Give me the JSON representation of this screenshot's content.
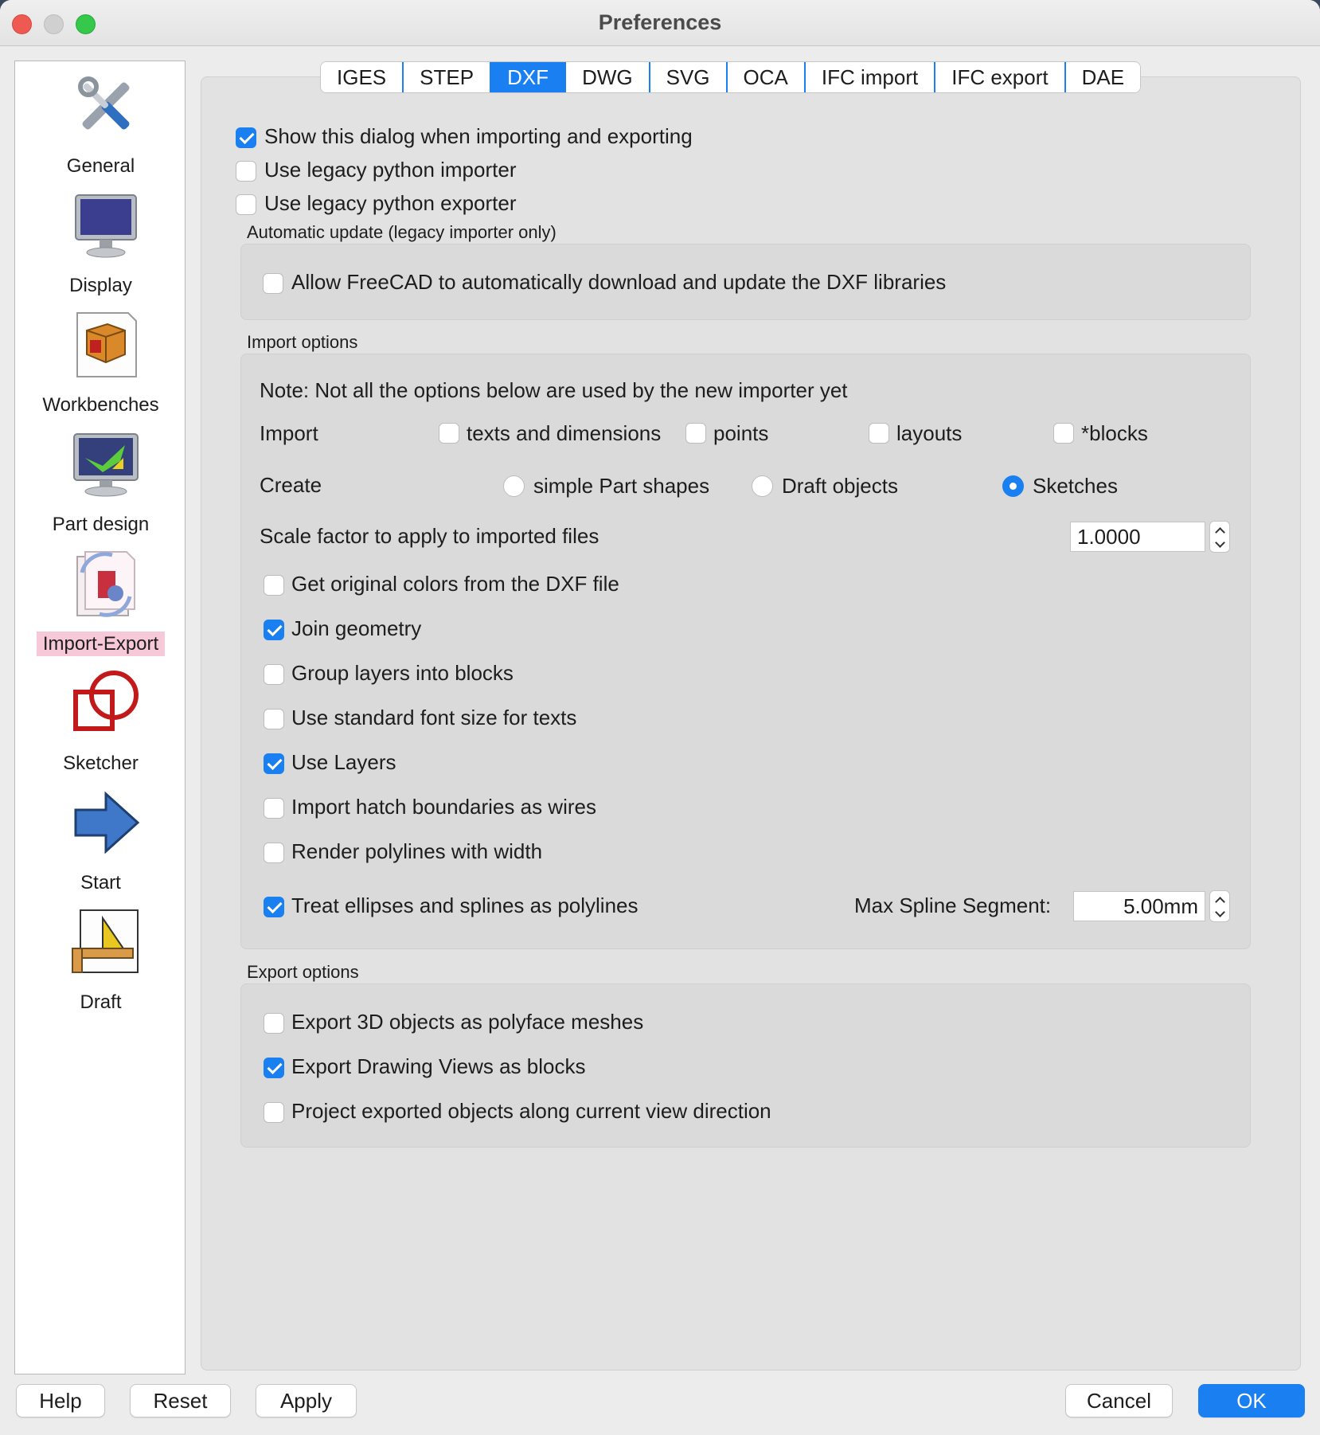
{
  "window": {
    "title": "Preferences"
  },
  "sidebar": {
    "items": [
      {
        "label": "General",
        "icon": "tools-icon"
      },
      {
        "label": "Display",
        "icon": "monitor-icon"
      },
      {
        "label": "Workbenches",
        "icon": "package-icon"
      },
      {
        "label": "Part design",
        "icon": "part-design-icon"
      },
      {
        "label": "Import-Export",
        "icon": "import-export-icon",
        "active": true
      },
      {
        "label": "Sketcher",
        "icon": "sketcher-icon"
      },
      {
        "label": "Start",
        "icon": "arrow-right-icon"
      },
      {
        "label": "Draft",
        "icon": "draft-icon"
      }
    ]
  },
  "tabs": [
    "IGES",
    "STEP",
    "DXF",
    "DWG",
    "SVG",
    "OCA",
    "IFC import",
    "IFC export",
    "DAE"
  ],
  "active_tab": "DXF",
  "general": {
    "show_dialog": {
      "label": "Show this dialog when importing and exporting",
      "checked": true
    },
    "legacy_importer": {
      "label": "Use legacy python importer",
      "checked": false
    },
    "legacy_exporter": {
      "label": "Use legacy python exporter",
      "checked": false
    }
  },
  "auto_update": {
    "title": "Automatic update (legacy importer only)",
    "allow_download": {
      "label": "Allow FreeCAD to automatically download and update the DXF libraries",
      "checked": false
    }
  },
  "import_options": {
    "title": "Import options",
    "note": "Note: Not all the options below are used by the new importer yet",
    "import_label": "Import",
    "import_items": [
      {
        "label": "texts and dimensions",
        "checked": false
      },
      {
        "label": "points",
        "checked": false
      },
      {
        "label": "layouts",
        "checked": false
      },
      {
        "label": "*blocks",
        "checked": false
      }
    ],
    "create_label": "Create",
    "create_items": [
      {
        "label": "simple Part shapes",
        "checked": false
      },
      {
        "label": "Draft objects",
        "checked": false
      },
      {
        "label": "Sketches",
        "checked": true
      }
    ],
    "scale_label": "Scale factor to apply to imported files",
    "scale_value": "1.0000",
    "options": [
      {
        "label": "Get original colors from the DXF file",
        "checked": false
      },
      {
        "label": "Join geometry",
        "checked": true
      },
      {
        "label": "Group layers into blocks",
        "checked": false
      },
      {
        "label": "Use standard font size for texts",
        "checked": false
      },
      {
        "label": "Use Layers",
        "checked": true
      },
      {
        "label": "Import hatch boundaries as wires",
        "checked": false
      },
      {
        "label": "Render polylines with width",
        "checked": false
      },
      {
        "label": "Treat ellipses and splines as polylines",
        "checked": true
      }
    ],
    "max_spline_label": "Max Spline Segment:",
    "max_spline_value": "5.00mm"
  },
  "export_options": {
    "title": "Export options",
    "options": [
      {
        "label": "Export 3D objects as polyface meshes",
        "checked": false
      },
      {
        "label": "Export Drawing Views as blocks",
        "checked": true
      },
      {
        "label": "Project exported objects along current view direction",
        "checked": false
      }
    ]
  },
  "buttons": {
    "help": "Help",
    "reset": "Reset",
    "apply": "Apply",
    "cancel": "Cancel",
    "ok": "OK"
  },
  "colors": {
    "accent": "#1a7ff0",
    "active_sidebar": "#f7c9d8"
  }
}
